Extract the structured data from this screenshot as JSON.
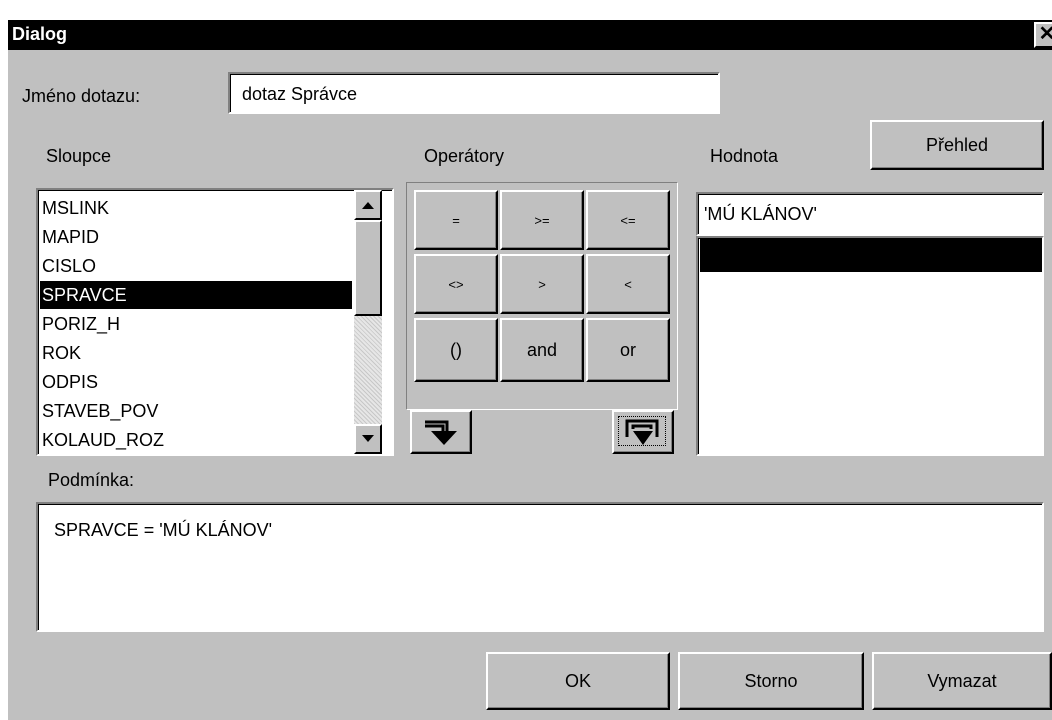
{
  "dialog": {
    "title": "Dialog",
    "close_glyph": "✕"
  },
  "query_name": {
    "label": "Jméno dotazu:",
    "value": "dotaz Správce"
  },
  "columns": {
    "label": "Sloupce",
    "items": [
      "MSLINK",
      "MAPID",
      "CISLO",
      "SPRAVCE",
      "PORIZ_H",
      "ROK",
      "ODPIS",
      "STAVEB_POV",
      "KOLAUD_ROZ"
    ],
    "selected": "SPRAVCE"
  },
  "operators": {
    "label": "Operátory",
    "buttons": [
      "=",
      ">=",
      "<=",
      "<>",
      ">",
      "<",
      "()",
      "and",
      "or"
    ]
  },
  "value": {
    "label": "Hodnota",
    "browse_button": "Přehled",
    "input": "'MÚ KLÁNOV'"
  },
  "condition": {
    "label": "Podmínka:",
    "text": "SPRAVCE = 'MÚ KLÁNOV'"
  },
  "footer": {
    "ok": "OK",
    "cancel": "Storno",
    "clear": "Vymazat"
  }
}
